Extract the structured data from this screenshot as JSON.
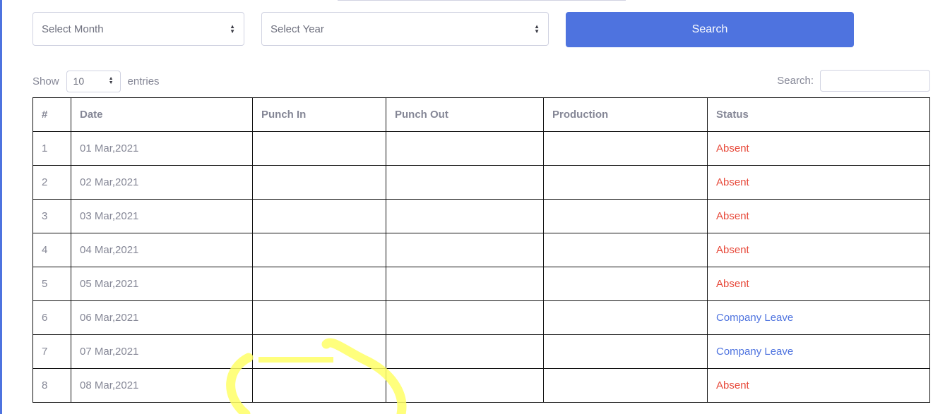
{
  "filters": {
    "month_placeholder": "Select Month",
    "year_placeholder": "Select Year",
    "search_button_label": "Search"
  },
  "table_controls": {
    "show_label": "Show",
    "entries_count": "10",
    "entries_label": "entries",
    "search_label": "Search:",
    "search_value": ""
  },
  "table": {
    "headers": [
      "#",
      "Date",
      "Punch In",
      "Punch Out",
      "Production",
      "Status"
    ],
    "rows": [
      {
        "num": "1",
        "date": "01 Mar,2021",
        "punch_in": "",
        "punch_out": "",
        "production": "",
        "status": "Absent"
      },
      {
        "num": "2",
        "date": "02 Mar,2021",
        "punch_in": "",
        "punch_out": "",
        "production": "",
        "status": "Absent"
      },
      {
        "num": "3",
        "date": "03 Mar,2021",
        "punch_in": "",
        "punch_out": "",
        "production": "",
        "status": "Absent"
      },
      {
        "num": "4",
        "date": "04 Mar,2021",
        "punch_in": "",
        "punch_out": "",
        "production": "",
        "status": "Absent"
      },
      {
        "num": "5",
        "date": "05 Mar,2021",
        "punch_in": "",
        "punch_out": "",
        "production": "",
        "status": "Absent"
      },
      {
        "num": "6",
        "date": "06 Mar,2021",
        "punch_in": "",
        "punch_out": "",
        "production": "",
        "status": "Company Leave"
      },
      {
        "num": "7",
        "date": "07 Mar,2021",
        "punch_in": "",
        "punch_out": "",
        "production": "",
        "status": "Company Leave"
      },
      {
        "num": "8",
        "date": "08 Mar,2021",
        "punch_in": "",
        "punch_out": "",
        "production": "",
        "status": "Absent"
      }
    ]
  },
  "colors": {
    "accent": "#4e73df",
    "absent": "#e74a3b",
    "leave": "#4e73df",
    "highlight_annotation": "#ffff66"
  }
}
